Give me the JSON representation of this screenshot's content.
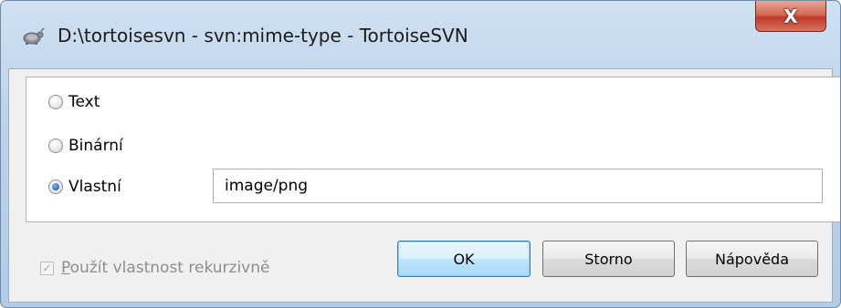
{
  "window": {
    "title": "D:\\tortoisesvn - svn:mime-type - TortoiseSVN",
    "close_label": "X"
  },
  "mime_type": {
    "options": [
      {
        "label": "Text",
        "checked": false
      },
      {
        "label": "Binární",
        "checked": false
      },
      {
        "label": "Vlastní",
        "checked": true
      }
    ],
    "custom_value": "image/png"
  },
  "recursive": {
    "label_prefix": "P",
    "label_rest": "oužít vlastnost rekurzivně",
    "checked": true,
    "enabled": false,
    "check_glyph": "✓"
  },
  "buttons": {
    "ok": "OK",
    "cancel": "Storno",
    "help": "Nápověda"
  },
  "colors": {
    "close_button": "#c0392b",
    "default_button_border": "#3c7fb1"
  }
}
